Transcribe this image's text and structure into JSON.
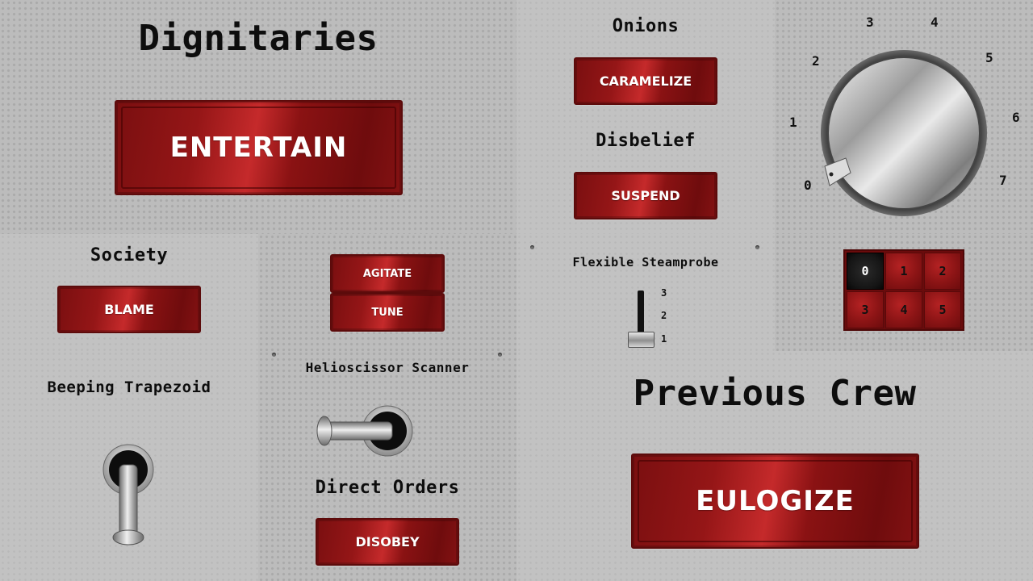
{
  "panels": {
    "dignitaries": {
      "title": "Dignitaries",
      "button": "ENTERTAIN"
    },
    "onions": {
      "title": "Onions",
      "button": "CARAMELIZE"
    },
    "disbelief": {
      "title": "Disbelief",
      "button": "SUSPEND"
    },
    "dial": {
      "numbers": [
        "0",
        "1",
        "2",
        "3",
        "4",
        "5",
        "6",
        "7"
      ],
      "selected": "0"
    },
    "society": {
      "title": "Society",
      "button": "BLAME"
    },
    "pair_buttons": {
      "top": "AGITATE",
      "bottom": "TUNE"
    },
    "steamprobe": {
      "title": "Flexible Steamprobe",
      "levels": [
        "3",
        "2",
        "1"
      ],
      "value": "1"
    },
    "keypad": {
      "keys": [
        "0",
        "1",
        "2",
        "3",
        "4",
        "5"
      ],
      "selected": "0"
    },
    "trapezoid": {
      "title": "Beeping Trapezoid",
      "state": "down"
    },
    "scanner": {
      "title": "Helioscissor Scanner",
      "state": "left"
    },
    "direct_orders": {
      "title": "Direct Orders",
      "button": "DISOBEY"
    },
    "previous_crew": {
      "title": "Previous Crew",
      "button": "EULOGIZE"
    }
  },
  "colors": {
    "button_red": "#951617",
    "panel_gray": "#bcbcbc",
    "text": "#0d0d0d"
  }
}
